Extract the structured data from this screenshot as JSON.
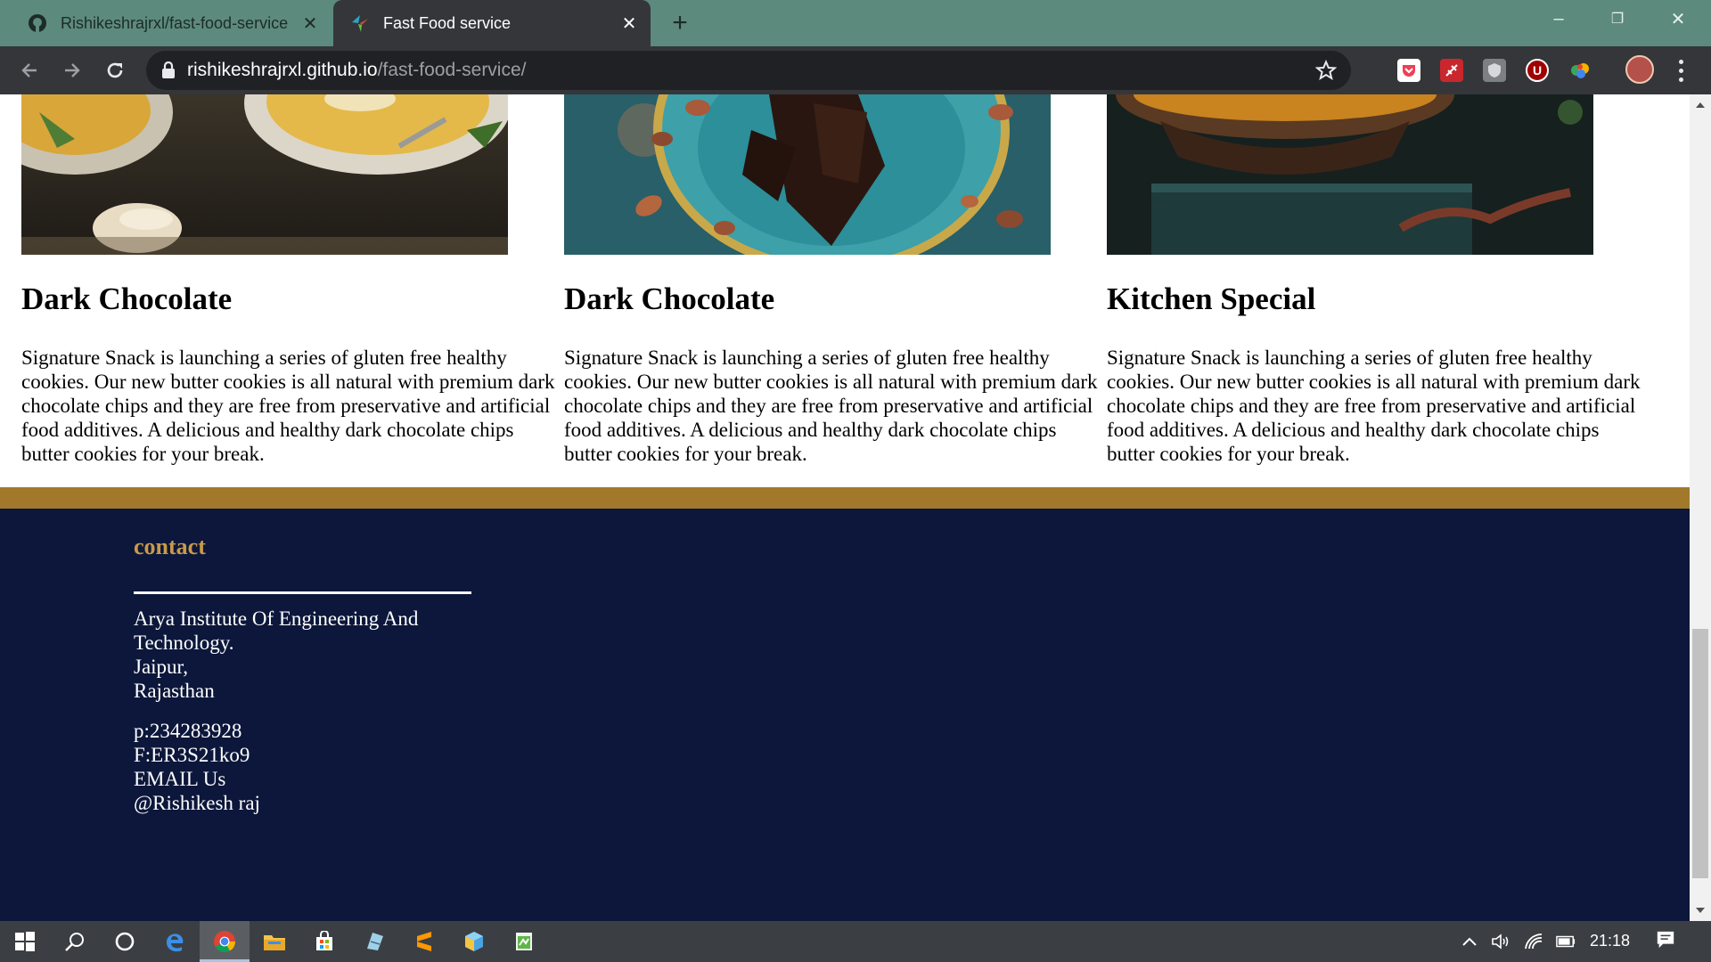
{
  "browser": {
    "tabs": [
      {
        "title": "Rishikeshrajrxl/fast-food-service",
        "active": false
      },
      {
        "title": "Fast Food service",
        "active": true
      }
    ],
    "url_host": "rishikeshrajrxl.github.io",
    "url_path": "/fast-food-service/",
    "window_controls": {
      "minimize": "–",
      "restore": "❐",
      "close": "✕"
    },
    "extensions": [
      "pocket-icon",
      "flight-icon",
      "shield-extension-icon",
      "ublock-icon",
      "colorful-extension-icon"
    ],
    "extension_labels": {
      "ublock": "U"
    }
  },
  "cards": [
    {
      "title": "Dark Chocolate",
      "text": "Signature Snack is launching a series of gluten free healthy cookies. Our new butter cookies is all natural with premium dark chocolate chips and they are free from preservative and artificial food additives. A delicious and healthy dark chocolate chips butter cookies for your break.",
      "image": "soup-bowl-photo"
    },
    {
      "title": "Dark Chocolate",
      "text": "Signature Snack is launching a series of gluten free healthy cookies. Our new butter cookies is all natural with premium dark chocolate chips and they are free from preservative and artificial food additives. A delicious and healthy dark chocolate chips butter cookies for your break.",
      "image": "chocolate-plate-photo"
    },
    {
      "title": "Kitchen Special",
      "text": "Signature Snack is launching a series of gluten free healthy cookies. Our new butter cookies is all natural with premium dark chocolate chips and they are free from preservative and artificial food additives. A delicious and healthy dark chocolate chips butter cookies for your break.",
      "image": "spice-pot-photo"
    }
  ],
  "footer": {
    "heading": "contact",
    "address": [
      "Arya Institute Of Engineering And",
      "Technology.",
      "Jaipur,",
      "Rajasthan"
    ],
    "details": [
      "p:234283928",
      "F:ER3S21ko9",
      "EMAIL Us",
      "@Rishikesh raj"
    ]
  },
  "taskbar": {
    "clock": "21:18",
    "apps": [
      "windows-start-icon",
      "search-icon",
      "cortana-icon",
      "edge-icon",
      "chrome-icon",
      "file-explorer-icon",
      "store-icon",
      "notepad-icon",
      "sublime-icon",
      "cube-app-icon",
      "notes-app-icon"
    ]
  },
  "colors": {
    "tab_strip": "#5c8a7c",
    "toolbar": "#35363a",
    "gold_band": "#a2792a",
    "footer_bg": "#0c173b",
    "contact_heading": "#c89a4a"
  }
}
